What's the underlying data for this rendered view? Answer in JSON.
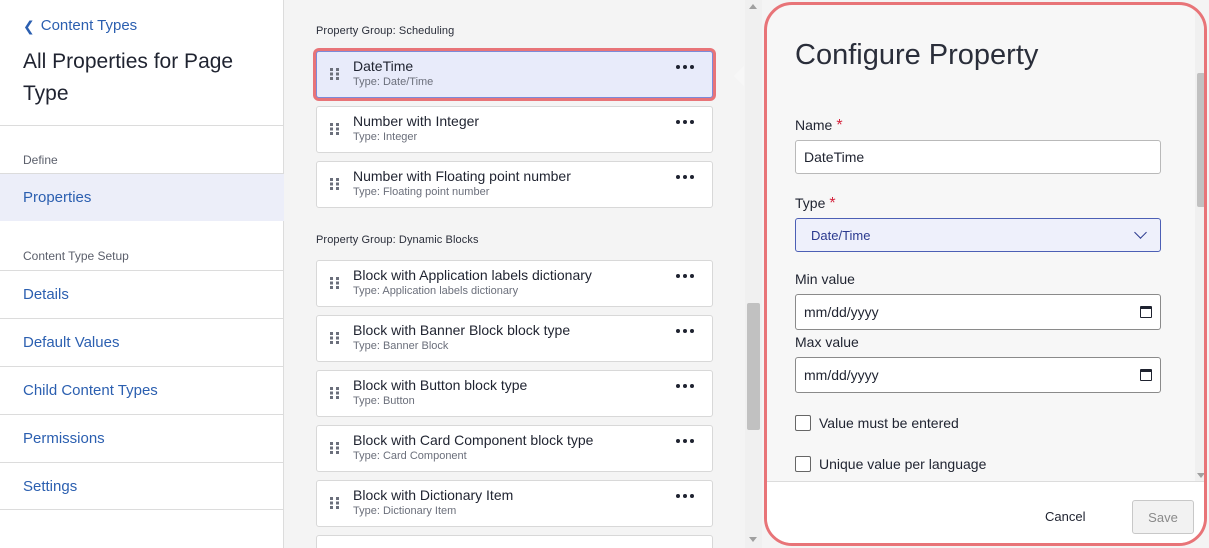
{
  "sidebar": {
    "back_label": "Content Types",
    "page_title": "All Properties for Page Type",
    "define_label": "Define",
    "define_items": [
      {
        "label": "Properties",
        "active": true
      }
    ],
    "setup_label": "Content Type Setup",
    "setup_items": [
      {
        "label": "Details"
      },
      {
        "label": "Default Values"
      },
      {
        "label": "Child Content Types"
      },
      {
        "label": "Permissions"
      },
      {
        "label": "Settings"
      }
    ]
  },
  "groups": [
    {
      "label": "Property Group: Scheduling",
      "properties": [
        {
          "name": "DateTime",
          "type": "Type: Date/Time",
          "selected": true
        },
        {
          "name": "Number with Integer",
          "type": "Type: Integer"
        },
        {
          "name": "Number with Floating point number",
          "type": "Type: Floating point number"
        }
      ]
    },
    {
      "label": "Property Group: Dynamic Blocks",
      "properties": [
        {
          "name": "Block with Application labels dictionary",
          "type": "Type: Application labels dictionary"
        },
        {
          "name": "Block with Banner Block block type",
          "type": "Type: Banner Block"
        },
        {
          "name": "Block with Button block type",
          "type": "Type: Button"
        },
        {
          "name": "Block with Card Component block type",
          "type": "Type: Card Component"
        },
        {
          "name": "Block with Dictionary Item",
          "type": "Type: Dictionary Item"
        }
      ]
    }
  ],
  "panel": {
    "title": "Configure Property",
    "name_label": "Name",
    "name_value": "DateTime",
    "type_label": "Type",
    "type_value": "Date/Time",
    "min_label": "Min value",
    "min_placeholder": "mm/dd/yyyy",
    "max_label": "Max value",
    "max_placeholder": "mm/dd/yyyy",
    "required_marker": "*",
    "checkboxes": [
      {
        "label": "Value must be entered",
        "checked": false
      },
      {
        "label": "Unique value per language",
        "checked": false
      }
    ],
    "cancel_label": "Cancel",
    "save_label": "Save"
  },
  "colors": {
    "link": "#2b5fb0",
    "highlight": "#e87478",
    "selected_bg": "#e8ebfa",
    "required": "#d4213b"
  }
}
